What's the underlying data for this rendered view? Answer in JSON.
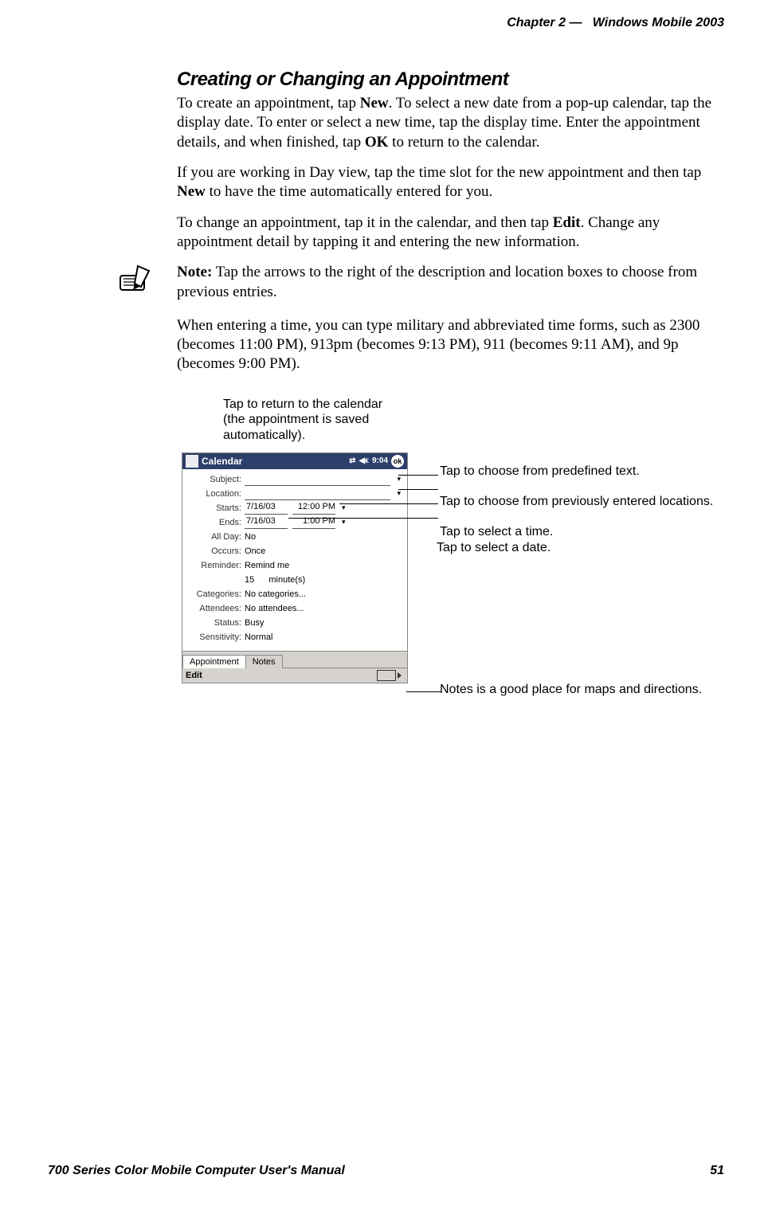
{
  "header": {
    "chapter": "Chapter 2",
    "dash": "—",
    "product": "Windows Mobile 2003"
  },
  "section": {
    "title": "Creating or Changing an Appointment",
    "p1_a": "To create an appointment, tap ",
    "p1_new": "New",
    "p1_b": ". To select a new date from a pop-up calendar, tap the display date. To enter or select a new time, tap the display time. Enter the appointment details, and when finished, tap ",
    "p1_ok": "OK",
    "p1_c": " to return to the calendar.",
    "p2_a": "If you are working in Day view, tap the time slot for the new appointment and then tap ",
    "p2_new": "New",
    "p2_b": " to have the time automatically entered for you.",
    "p3_a": "To change an appointment, tap it in the calendar, and then tap ",
    "p3_edit": "Edit",
    "p3_b": ". Change any appointment detail by tapping it and entering the new information.",
    "note_label": "Note:",
    "note_text": " Tap the arrows to the right of the description and location boxes to choose from previous entries.",
    "p4": "When entering a time, you can type military and abbreviated time forms, such as 2300 (becomes 11:00 PM), 913pm (becomes 9:13 PM), 911 (becomes 9:11 AM), and 9p (becomes 9:00 PM)."
  },
  "callouts": {
    "top": "Tap to return to the calendar (the appointment is saved automatically).",
    "r1": "Tap to choose from predefined text.",
    "r2": "Tap to choose from previously entered locations.",
    "r3": "Tap to select a time.",
    "r4": "Tap to select a date.",
    "r5": "Notes is a good place for maps and directions."
  },
  "device": {
    "title": "Calendar",
    "time": "9:04",
    "ok": "ok",
    "fields": {
      "subject_lbl": "Subject:",
      "location_lbl": "Location:",
      "starts_lbl": "Starts:",
      "ends_lbl": "Ends:",
      "allday_lbl": "All Day:",
      "occurs_lbl": "Occurs:",
      "reminder_lbl": "Reminder:",
      "categories_lbl": "Categories:",
      "attendees_lbl": "Attendees:",
      "status_lbl": "Status:",
      "sensitivity_lbl": "Sensitivity:",
      "start_date": "7/16/03",
      "start_time": "12:00 PM",
      "end_date": "7/16/03",
      "end_time": "1:00 PM",
      "allday": "No",
      "occurs": "Once",
      "reminder": "Remind me",
      "reminder2_a": "15",
      "reminder2_b": "minute(s)",
      "categories": "No categories...",
      "attendees": "No attendees...",
      "status": "Busy",
      "sensitivity": "Normal"
    },
    "tabs": {
      "appointment": "Appointment",
      "notes": "Notes"
    },
    "softkey": "Edit"
  },
  "footer": {
    "left": "700 Series Color Mobile Computer User's Manual",
    "right": "51"
  }
}
